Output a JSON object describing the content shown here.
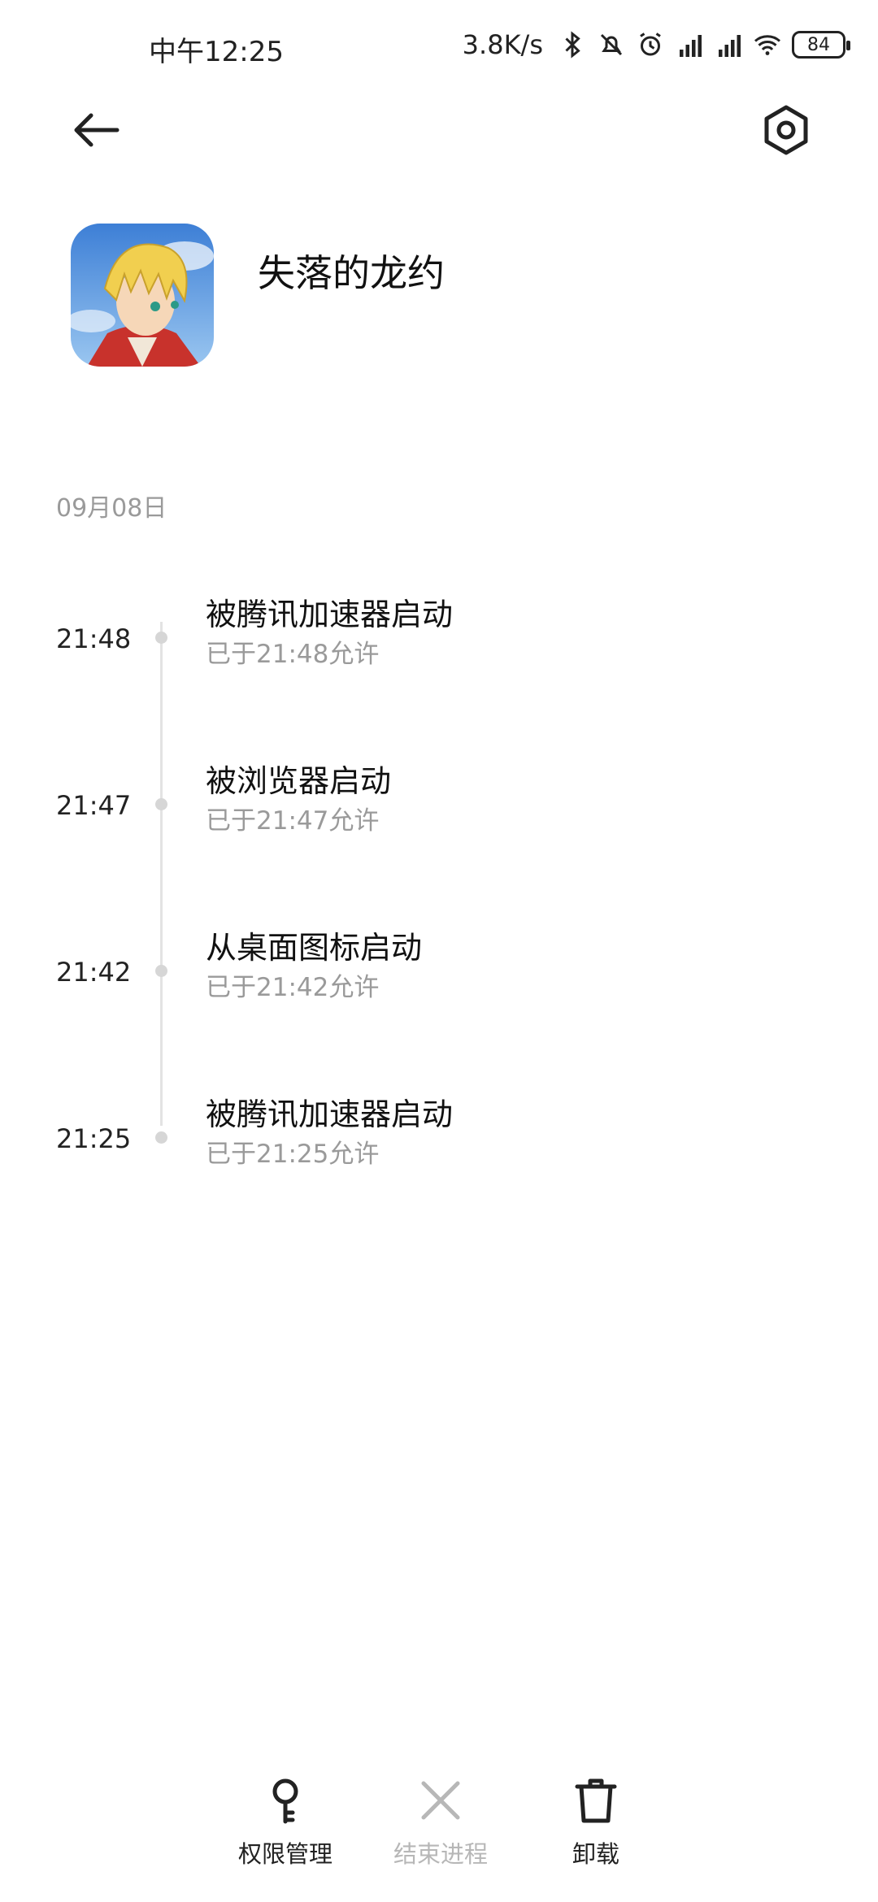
{
  "status_bar": {
    "time": "中午12:25",
    "net_speed": "3.8K/s",
    "battery": "84",
    "icons": [
      "bluetooth-icon",
      "mute-icon",
      "alarm-icon",
      "hd-signal-icon",
      "hd-signal-icon",
      "wifi-icon"
    ]
  },
  "header": {
    "back_icon": "back-arrow-icon",
    "settings_icon": "settings-icon"
  },
  "app": {
    "name": "失落的龙约"
  },
  "log": {
    "date": "09月08日",
    "entries": [
      {
        "time": "21:48",
        "title": "被腾讯加速器启动",
        "subtitle": "已于21:48允许"
      },
      {
        "time": "21:47",
        "title": "被浏览器启动",
        "subtitle": "已于21:47允许"
      },
      {
        "time": "21:42",
        "title": "从桌面图标启动",
        "subtitle": "已于21:42允许"
      },
      {
        "time": "21:25",
        "title": "被腾讯加速器启动",
        "subtitle": "已于21:25允许"
      }
    ]
  },
  "actions": {
    "permissions": {
      "label": "权限管理",
      "icon": "key-icon",
      "enabled": true
    },
    "force_stop": {
      "label": "结束进程",
      "icon": "close-icon",
      "enabled": false
    },
    "uninstall": {
      "label": "卸载",
      "icon": "trash-icon",
      "enabled": true
    }
  },
  "colors": {
    "primary_text": "#111111",
    "secondary_text": "#9a9a9a",
    "disabled": "#b7b7b7",
    "timeline": "#e3e3e3"
  }
}
